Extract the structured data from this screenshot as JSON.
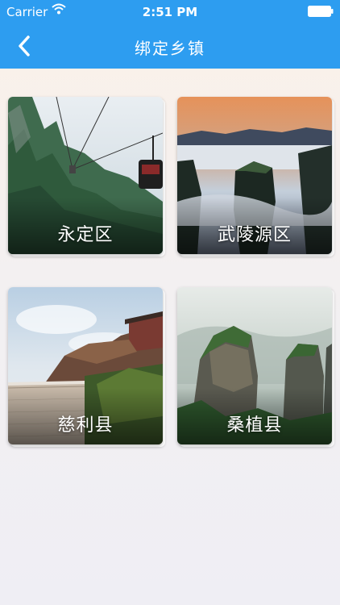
{
  "status_bar": {
    "carrier": "Carrier",
    "time": "2:51 PM",
    "wifi_icon": "wifi-icon",
    "battery_icon": "battery-icon"
  },
  "header": {
    "title": "绑定乡镇",
    "back_icon": "chevron-left-icon",
    "bg_color": "#2d9df0"
  },
  "towns": [
    {
      "name": "永定区",
      "image": "cable-car-mountain-photo"
    },
    {
      "name": "武陵源区",
      "image": "sunrise-peaks-photo"
    },
    {
      "name": "慈利县",
      "image": "temple-wall-photo"
    },
    {
      "name": "桑植县",
      "image": "forest-pillars-photo"
    }
  ]
}
